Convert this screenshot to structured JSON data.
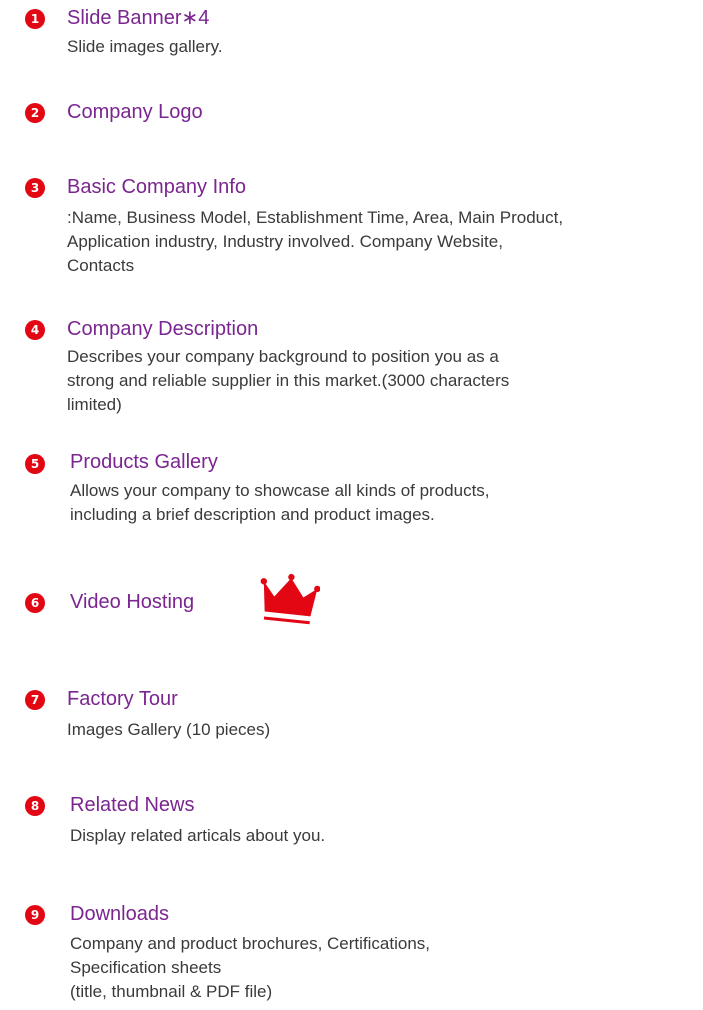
{
  "brand_color": "#e30613",
  "title_color": "#7b2590",
  "text_color": "#3a3a3a",
  "items": [
    {
      "num": "1",
      "title": "Slide Banner∗4",
      "lines": [
        "Slide images gallery."
      ]
    },
    {
      "num": "2",
      "title": "Company Logo",
      "lines": []
    },
    {
      "num": "3",
      "title": "Basic Company Info",
      "lines": [
        ":Name, Business Model, Establishment Time, Area,  Main Product,",
        "Application industry, Industry involved. Company Website,",
        "Contacts"
      ]
    },
    {
      "num": "4",
      "title": "Company Description",
      "lines": [
        "Describes your company background to position you as a",
        "strong and reliable supplier in this market.(3000 characters",
        "limited)"
      ]
    },
    {
      "num": "5",
      "title": "Products Gallery",
      "lines": [
        "Allows your company to showcase all kinds of products,",
        "including a brief description and product images."
      ]
    },
    {
      "num": "6",
      "title": "Video Hosting",
      "lines": [],
      "icon": "crown-icon"
    },
    {
      "num": "7",
      "title": "Factory Tour",
      "lines": [
        "Images Gallery (10 pieces)"
      ]
    },
    {
      "num": "8",
      "title": "Related News",
      "lines": [
        "Display related articals about you."
      ]
    },
    {
      "num": "9",
      "title": "Downloads",
      "lines": [
        "Company and product brochures, Certifications,",
        "Specification sheets",
        "(title, thumbnail & PDF file)"
      ]
    }
  ]
}
